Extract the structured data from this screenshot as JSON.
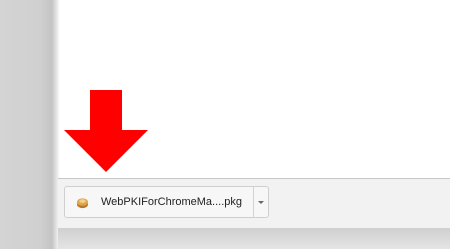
{
  "download_shelf": {
    "items": [
      {
        "file_name": "WebPKIForChromeMa....pkg",
        "icon": "package-icon"
      }
    ],
    "menu_icon": "chevron-down-icon"
  },
  "annotation": {
    "icon": "arrow-down-icon",
    "color": "#ff0000"
  }
}
